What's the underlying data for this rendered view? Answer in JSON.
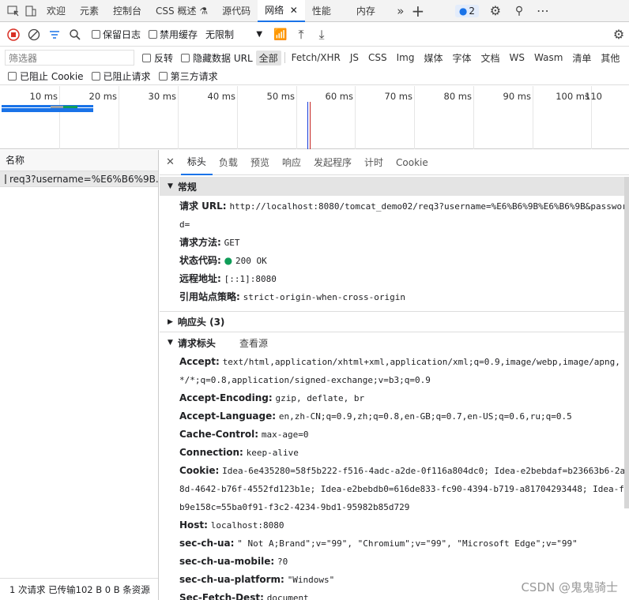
{
  "tabbar": {
    "tabs": [
      "欢迎",
      "元素",
      "控制台",
      "CSS 概述",
      "源代码",
      "网络",
      "性能",
      "内存"
    ],
    "active": "网络",
    "badge": "2"
  },
  "toolbar": {
    "preserve_log": "保留日志",
    "disable_cache": "禁用缓存",
    "throttle": "无限制"
  },
  "filter": {
    "placeholder": "筛选器",
    "invert": "反转",
    "hide_data_url": "隐藏数据 URL",
    "types": [
      "全部",
      "Fetch/XHR",
      "JS",
      "CSS",
      "Img",
      "媒体",
      "字体",
      "文档",
      "WS",
      "Wasm",
      "清单",
      "其他"
    ],
    "blocked_cookie": "已阻止 Cookie",
    "blocked_request": "已阻止请求",
    "third_party": "第三方请求"
  },
  "overview": {
    "ticks": [
      "10 ms",
      "20 ms",
      "30 ms",
      "40 ms",
      "50 ms",
      "60 ms",
      "70 ms",
      "80 ms",
      "90 ms",
      "100 ms",
      "110"
    ]
  },
  "requests": {
    "header": "名称",
    "items": [
      "req3?username=%E6%B6%9B..."
    ],
    "status": "1 次请求  已传输102 B  0 B 条资源"
  },
  "details": {
    "tabs": [
      "标头",
      "负载",
      "预览",
      "响应",
      "发起程序",
      "计时",
      "Cookie"
    ],
    "general_title": "常规",
    "general": [
      {
        "k": "请求 URL:",
        "v": "http://localhost:8080/tomcat_demo02/req3?username=%E6%B6%9B%E6%B6%9B&password="
      },
      {
        "k": "请求方法:",
        "v": "GET"
      },
      {
        "k": "状态代码:",
        "v": "200 OK"
      },
      {
        "k": "远程地址:",
        "v": "[::1]:8080"
      },
      {
        "k": "引用站点策略:",
        "v": "strict-origin-when-cross-origin"
      }
    ],
    "response_headers": "响应头 (3)",
    "request_headers": "请求标头",
    "view_source": "查看源",
    "req_headers": [
      {
        "k": "Accept:",
        "v": "text/html,application/xhtml+xml,application/xml;q=0.9,image/webp,image/apng,*/*;q=0.8,application/signed-exchange;v=b3;q=0.9"
      },
      {
        "k": "Accept-Encoding:",
        "v": "gzip, deflate, br"
      },
      {
        "k": "Accept-Language:",
        "v": "en,zh-CN;q=0.9,zh;q=0.8,en-GB;q=0.7,en-US;q=0.6,ru;q=0.5"
      },
      {
        "k": "Cache-Control:",
        "v": "max-age=0"
      },
      {
        "k": "Connection:",
        "v": "keep-alive"
      },
      {
        "k": "Cookie:",
        "v": "Idea-6e435280=58f5b222-f516-4adc-a2de-0f116a804dc0; Idea-e2bebdaf=b23663b6-2a8d-4642-b76f-4552fd123b1e; Idea-e2bebdb0=616de833-fc90-4394-b719-a81704293448; Idea-fb9e158c=55ba0f91-f3c2-4234-9bd1-95982b85d729"
      },
      {
        "k": "Host:",
        "v": "localhost:8080"
      },
      {
        "k": "sec-ch-ua:",
        "v": "\" Not A;Brand\";v=\"99\", \"Chromium\";v=\"99\", \"Microsoft Edge\";v=\"99\""
      },
      {
        "k": "sec-ch-ua-mobile:",
        "v": "?0"
      },
      {
        "k": "sec-ch-ua-platform:",
        "v": "\"Windows\""
      },
      {
        "k": "Sec-Fetch-Dest:",
        "v": "document"
      }
    ]
  },
  "watermark": "CSDN @鬼鬼骑士"
}
